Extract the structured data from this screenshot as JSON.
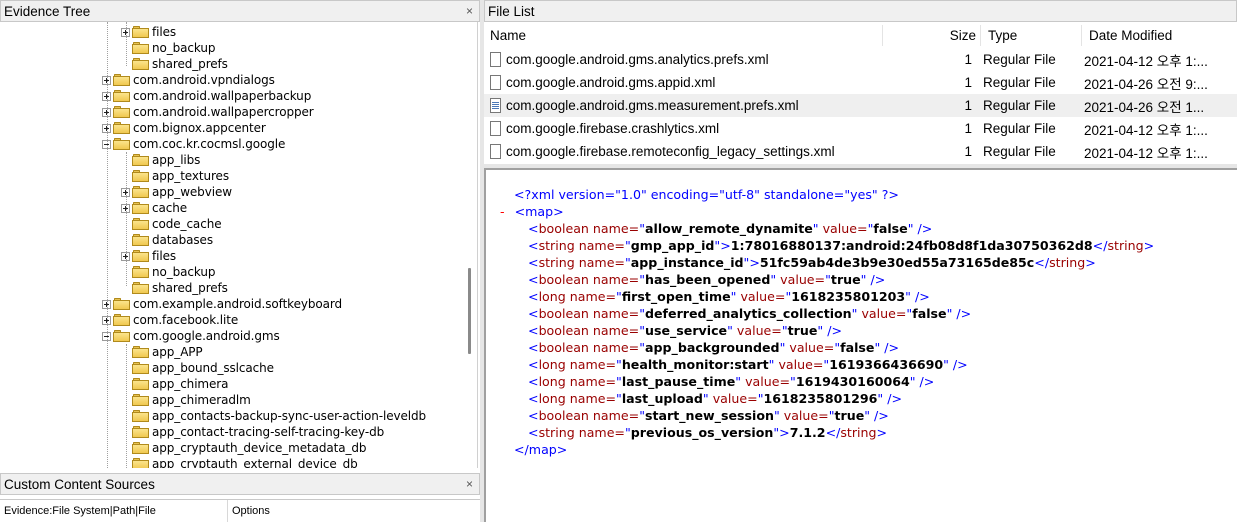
{
  "evidence_tree": {
    "title": "Evidence Tree",
    "close": "×",
    "rows": [
      {
        "label": "files",
        "depth": 1,
        "expander": "plus"
      },
      {
        "label": "no_backup",
        "depth": 1,
        "expander": "none"
      },
      {
        "label": "shared_prefs",
        "depth": 1,
        "expander": "none"
      },
      {
        "label": "com.android.vpndialogs",
        "depth": 0,
        "expander": "plus"
      },
      {
        "label": "com.android.wallpaperbackup",
        "depth": 0,
        "expander": "plus"
      },
      {
        "label": "com.android.wallpapercropper",
        "depth": 0,
        "expander": "plus"
      },
      {
        "label": "com.bignox.appcenter",
        "depth": 0,
        "expander": "plus"
      },
      {
        "label": "com.coc.kr.cocmsl.google",
        "depth": 0,
        "expander": "minus"
      },
      {
        "label": "app_libs",
        "depth": 1,
        "expander": "none"
      },
      {
        "label": "app_textures",
        "depth": 1,
        "expander": "none"
      },
      {
        "label": "app_webview",
        "depth": 1,
        "expander": "plus"
      },
      {
        "label": "cache",
        "depth": 1,
        "expander": "plus"
      },
      {
        "label": "code_cache",
        "depth": 1,
        "expander": "none"
      },
      {
        "label": "databases",
        "depth": 1,
        "expander": "none"
      },
      {
        "label": "files",
        "depth": 1,
        "expander": "plus"
      },
      {
        "label": "no_backup",
        "depth": 1,
        "expander": "none"
      },
      {
        "label": "shared_prefs",
        "depth": 1,
        "expander": "none"
      },
      {
        "label": "com.example.android.softkeyboard",
        "depth": 0,
        "expander": "plus"
      },
      {
        "label": "com.facebook.lite",
        "depth": 0,
        "expander": "plus"
      },
      {
        "label": "com.google.android.gms",
        "depth": 0,
        "expander": "minus"
      },
      {
        "label": "app_APP",
        "depth": 1,
        "expander": "none"
      },
      {
        "label": "app_bound_sslcache",
        "depth": 1,
        "expander": "none"
      },
      {
        "label": "app_chimera",
        "depth": 1,
        "expander": "none"
      },
      {
        "label": "app_chimeradlm",
        "depth": 1,
        "expander": "none"
      },
      {
        "label": "app_contacts-backup-sync-user-action-leveldb",
        "depth": 1,
        "expander": "none"
      },
      {
        "label": "app_contact-tracing-self-tracing-key-db",
        "depth": 1,
        "expander": "none"
      },
      {
        "label": "app_cryptauth_device_metadata_db",
        "depth": 1,
        "expander": "none"
      },
      {
        "label": "app_cryptauth_external_device_db",
        "depth": 1,
        "expander": "none"
      }
    ]
  },
  "custom_content": {
    "title": "Custom Content Sources",
    "close": "×",
    "col1": "Evidence:File System|Path|File",
    "col2": "Options"
  },
  "file_list": {
    "title": "File List",
    "columns": {
      "name": "Name",
      "size": "Size",
      "type": "Type",
      "date": "Date Modified"
    },
    "rows": [
      {
        "name": "com.google.android.gms.analytics.prefs.xml",
        "size": "1",
        "type": "Regular File",
        "date": "2021-04-12 오후 1:...",
        "selected": false
      },
      {
        "name": "com.google.android.gms.appid.xml",
        "size": "1",
        "type": "Regular File",
        "date": "2021-04-26 오전 9:...",
        "selected": false
      },
      {
        "name": "com.google.android.gms.measurement.prefs.xml",
        "size": "1",
        "type": "Regular File",
        "date": "2021-04-26 오전 1...",
        "selected": true
      },
      {
        "name": "com.google.firebase.crashlytics.xml",
        "size": "1",
        "type": "Regular File",
        "date": "2021-04-12 오후 1:...",
        "selected": false
      },
      {
        "name": "com.google.firebase.remoteconfig_legacy_settings.xml",
        "size": "1",
        "type": "Regular File",
        "date": "2021-04-12 오후 1:...",
        "selected": false
      }
    ]
  },
  "xml_viewer": {
    "decl": "<?xml version=\"1.0\" encoding=\"utf-8\" standalone=\"yes\" ?>",
    "collapse": "-",
    "map_open": "<map>",
    "map_close": "</map>",
    "entries": [
      {
        "tag": "boolean",
        "name": "allow_remote_dynamite",
        "value": "false",
        "kind": "attr"
      },
      {
        "tag": "string",
        "name": "gmp_app_id",
        "value": "1:78016880137:android:24fb08d8f1da30750362d8",
        "kind": "text"
      },
      {
        "tag": "string",
        "name": "app_instance_id",
        "value": "51fc59ab4de3b9e30ed55a73165de85c",
        "kind": "text"
      },
      {
        "tag": "boolean",
        "name": "has_been_opened",
        "value": "true",
        "kind": "attr"
      },
      {
        "tag": "long",
        "name": "first_open_time",
        "value": "1618235801203",
        "kind": "attr"
      },
      {
        "tag": "boolean",
        "name": "deferred_analytics_collection",
        "value": "false",
        "kind": "attr"
      },
      {
        "tag": "boolean",
        "name": "use_service",
        "value": "true",
        "kind": "attr"
      },
      {
        "tag": "boolean",
        "name": "app_backgrounded",
        "value": "false",
        "kind": "attr"
      },
      {
        "tag": "long",
        "name": "health_monitor:start",
        "value": "1619366436690",
        "kind": "attr"
      },
      {
        "tag": "long",
        "name": "last_pause_time",
        "value": "1619430160064",
        "kind": "attr"
      },
      {
        "tag": "long",
        "name": "last_upload",
        "value": "1618235801296",
        "kind": "attr"
      },
      {
        "tag": "boolean",
        "name": "start_new_session",
        "value": "true",
        "kind": "attr"
      },
      {
        "tag": "string",
        "name": "previous_os_version",
        "value": "7.1.2",
        "kind": "text"
      }
    ]
  },
  "colors": {
    "xml_tag": "#0000ff",
    "xml_attr": "#990000",
    "xml_value": "#000000",
    "collapse": "#ff0000",
    "selection": "#efefef"
  }
}
